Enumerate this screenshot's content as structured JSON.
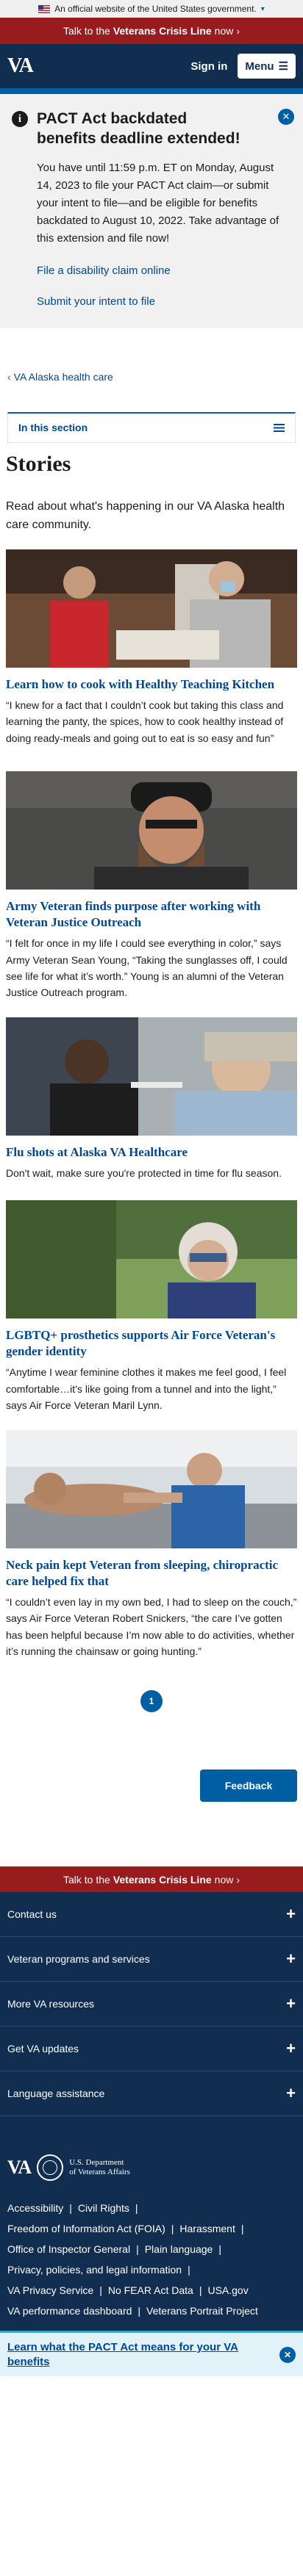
{
  "gov_banner": {
    "text": "An official website of the United States government."
  },
  "crisis_line": {
    "prefix": "Talk to the",
    "strong": "Veterans Crisis Line",
    "suffix": "now"
  },
  "header": {
    "logo": "VA",
    "sign_in": "Sign in",
    "menu": "Menu"
  },
  "alert": {
    "title": "PACT Act backdated benefits deadline extended!",
    "body": "You have until 11:59 p.m. ET on Monday, August 14, 2023 to file your PACT Act claim—or submit your intent to file—and be eligible for benefits backdated to August 10, 2022. Take advantage of this extension and file now!",
    "link1": "File a disability claim online",
    "link2": "Submit your intent to file"
  },
  "breadcrumb": {
    "label": "VA Alaska health care"
  },
  "section_nav": {
    "label": "In this section"
  },
  "page": {
    "title": "Stories",
    "intro": "Read about what's happening in our VA Alaska health care community."
  },
  "stories": [
    {
      "title": "Learn how to cook with Healthy Teaching Kitchen",
      "desc": "“I knew for a fact that I couldn’t cook but taking this class and learning the panty, the spices, how to cook healthy instead of doing ready-meals and going out to eat is so easy and fun”"
    },
    {
      "title": "Army Veteran finds purpose after working with Veteran Justice Outreach",
      "desc": "“I felt for once in my life I could see everything in color,” says Army Veteran Sean Young, “Taking the sunglasses off, I could see life for what it’s worth.” Young is an alumni of the Veteran Justice Outreach program."
    },
    {
      "title": "Flu shots at Alaska VA Healthcare",
      "desc": "Don't wait, make sure you're protected in time for flu season."
    },
    {
      "title": "LGBTQ+ prosthetics supports Air Force Veteran's gender identity",
      "desc": "“Anytime I wear feminine clothes it makes me feel good, I feel comfortable…it’s like going from a tunnel and into the light,” says Air Force Veteran Maril Lynn."
    },
    {
      "title": "Neck pain kept Veteran from sleeping, chiropractic care helped fix that",
      "desc": "“I couldn’t even lay in my own bed, I had to sleep on the couch,” says Air Force Veteran Robert Snickers, “the care I’ve gotten has been helpful because I’m now able to do activities, whether it’s running the chainsaw or going hunting.”"
    }
  ],
  "pager": {
    "current": "1"
  },
  "feedback": {
    "label": "Feedback"
  },
  "footer": {
    "accordions": [
      "Contact us",
      "Veteran programs and services",
      "More VA resources",
      "Get VA updates",
      "Language assistance"
    ],
    "logo": "VA",
    "dept_line1": "U.S. Department",
    "dept_line2": "of Veterans Affairs",
    "links": {
      "accessibility": "Accessibility",
      "civil_rights": "Civil Rights",
      "foia": "Freedom of Information Act (FOIA)",
      "harassment": "Harassment",
      "oig": "Office of Inspector General",
      "plain_language": "Plain language",
      "privacy": "Privacy, policies, and legal information",
      "privacy_service": "VA Privacy Service",
      "no_fear": "No FEAR Act Data",
      "usa_gov": "USA.gov",
      "performance": "VA performance dashboard",
      "portrait": "Veterans Portrait Project"
    }
  },
  "sticky": {
    "text": "Learn what the PACT Act means for your VA benefits"
  },
  "colors": {
    "primary": "#005ea2",
    "navy": "#112e51",
    "crisis": "#981b1e"
  }
}
